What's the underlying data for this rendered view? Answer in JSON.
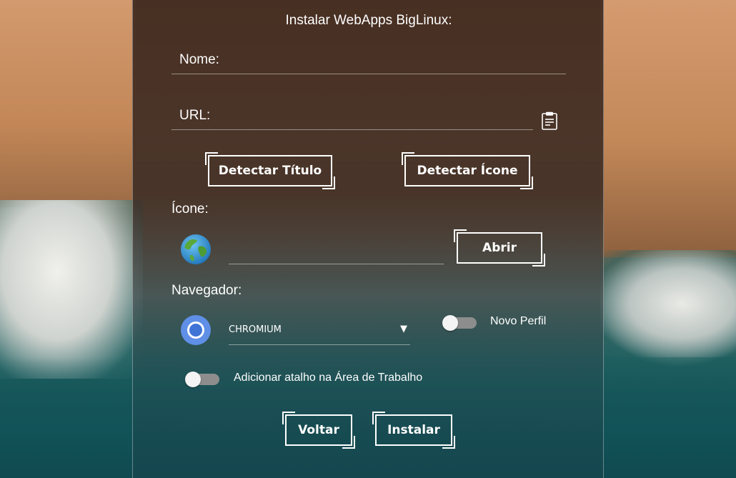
{
  "window": {
    "title": "Instalar WebApps BigLinux:"
  },
  "form": {
    "name_placeholder": "Nome:",
    "url_placeholder": "URL:",
    "icon_path_value": "",
    "paste_icon": "clipboard-icon"
  },
  "buttons": {
    "detect_title": "Detectar Título",
    "detect_icon": "Detectar Ícone",
    "open": "Abrir",
    "back": "Voltar",
    "install": "Instalar"
  },
  "labels": {
    "icon": "Ícone:",
    "browser": "Navegador:",
    "new_profile": "Novo Perfil",
    "desktop_shortcut": "Adicionar atalho na Área de Trabalho"
  },
  "browser": {
    "selected": "CHROMIUM",
    "icon": "chromium-icon"
  },
  "toggles": {
    "new_profile_on": false,
    "desktop_shortcut_on": false
  },
  "icons": {
    "webapp_icon": "globe-icon"
  },
  "colors": {
    "accent": "#ffffff",
    "toggle_track": "#8d8d8d"
  }
}
